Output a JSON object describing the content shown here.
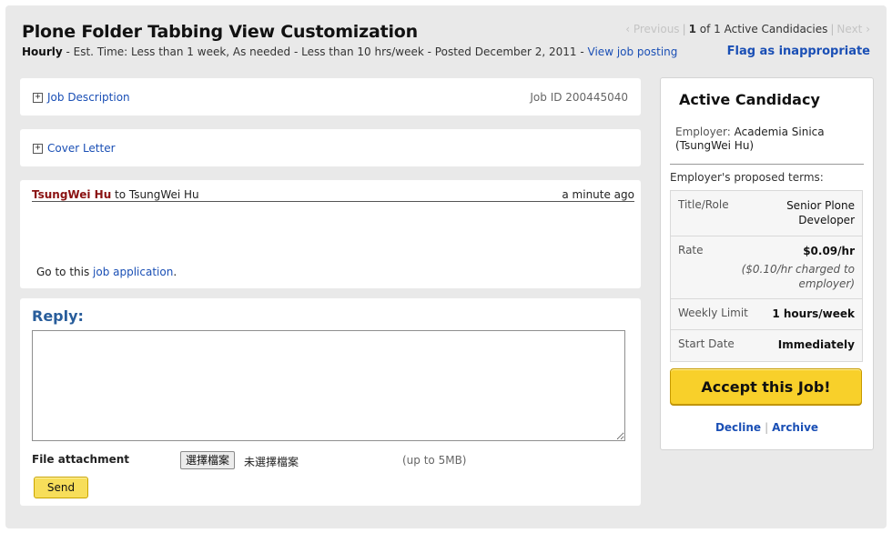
{
  "header": {
    "title": "Plone Folder Tabbing View Customization",
    "type": "Hourly",
    "details": " - Est. Time: Less than 1 week, As needed - Less than 10 hrs/week - Posted December 2, 2011 - ",
    "view_posting": "View job posting",
    "flag": "Flag as inappropriate"
  },
  "pager": {
    "previous": "‹ Previous",
    "current": "1",
    "summary": " of 1 Active Candidacies",
    "next": "Next ›"
  },
  "accordion": {
    "job_description": "Job Description",
    "job_id": "Job ID 200445040",
    "cover_letter": "Cover Letter"
  },
  "message": {
    "sender": "TsungWei Hu",
    "to_text": " to TsungWei Hu",
    "time": "a minute ago",
    "footer_prefix": "Go to this ",
    "footer_link": "job application",
    "footer_suffix": "."
  },
  "reply": {
    "title": "Reply:",
    "textarea_value": "",
    "attachment_label": "File attachment",
    "file_button": "選擇檔案",
    "file_none": "未選擇檔案",
    "file_limit": "(up to 5MB)",
    "send": "Send"
  },
  "sidebar": {
    "title": "Active Candidacy",
    "employer_label": "Employer:",
    "employer_name": " Academia Sinica (TsungWei Hu)",
    "terms_header": "Employer's proposed terms:",
    "terms": [
      {
        "key": "Title/Role",
        "value": "Senior Plone Developer"
      },
      {
        "key": "Rate",
        "value": "$0.09/hr",
        "note": "($0.10/hr charged to employer)"
      },
      {
        "key": "Weekly Limit",
        "value": "1 hours/week"
      },
      {
        "key": "Start Date",
        "value": "Immediately"
      }
    ],
    "accept": "Accept this Job!",
    "decline": "Decline",
    "separator": "|",
    "archive": "Archive"
  },
  "colors": {
    "link": "#1a4fb5",
    "sender": "#8a1111",
    "reply_title": "#285d9b",
    "accept_button": "#f8d02a",
    "background": "#e9e9e9"
  }
}
